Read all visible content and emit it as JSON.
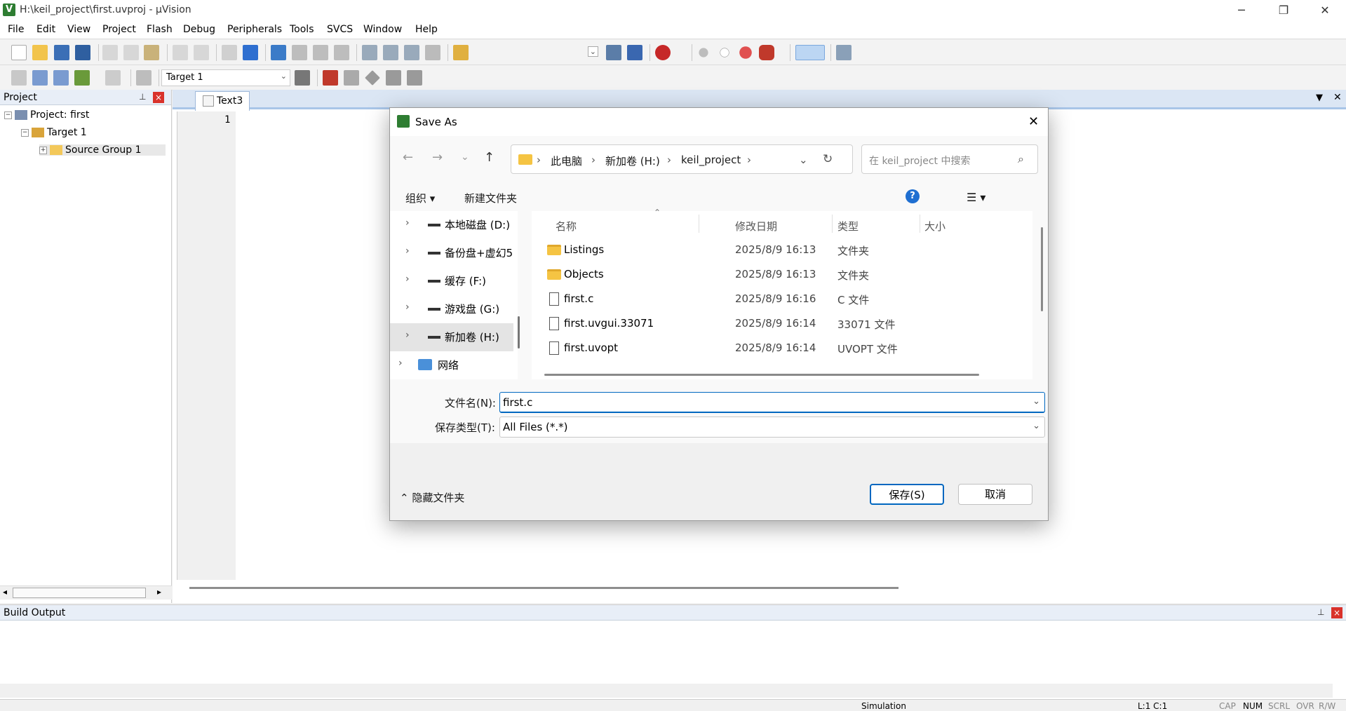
{
  "window": {
    "title": "H:\\keil_project\\first.uvproj - µVision",
    "app_icon": "V",
    "minimize": "─",
    "maximize": "❐",
    "close": "✕"
  },
  "menu": [
    "File",
    "Edit",
    "View",
    "Project",
    "Flash",
    "Debug",
    "Peripherals",
    "Tools",
    "SVCS",
    "Window",
    "Help"
  ],
  "toolbar2": {
    "target": "Target 1"
  },
  "project_panel": {
    "title": "Project",
    "pin": "⊥",
    "close": "×",
    "tree": {
      "project": "Project: first",
      "target": "Target 1",
      "group": "Source Group 1"
    }
  },
  "editor": {
    "tab": "Text3",
    "line_number": "1"
  },
  "build_output": {
    "title": "Build Output"
  },
  "statusbar": {
    "mode": "Simulation",
    "position": "L:1 C:1",
    "indicators": [
      "CAP",
      "NUM",
      "SCRL",
      "OVR",
      "R/W"
    ]
  },
  "dialog": {
    "title": "Save As",
    "close": "✕",
    "nav": {
      "back": "←",
      "forward": "→",
      "recent": "⌄",
      "up": "↑"
    },
    "breadcrumb": [
      "此电脑",
      "新加卷 (H:)",
      "keil_project"
    ],
    "refresh": "↻",
    "search_placeholder": "在 keil_project 中搜索",
    "commands": {
      "organize": "组织 ▾",
      "new_folder": "新建文件夹"
    },
    "help": "?",
    "nav_items": [
      {
        "label": "本地磁盘 (D:)"
      },
      {
        "label": "备份盘+虚幻5"
      },
      {
        "label": "缓存 (F:)"
      },
      {
        "label": "游戏盘 (G:)"
      },
      {
        "label": "新加卷 (H:)",
        "selected": true
      },
      {
        "label": "网络"
      }
    ],
    "columns": {
      "name": "名称",
      "date": "修改日期",
      "type": "类型",
      "size": "大小"
    },
    "files": [
      {
        "name": "Listings",
        "date": "2025/8/9 16:13",
        "type": "文件夹",
        "kind": "folder"
      },
      {
        "name": "Objects",
        "date": "2025/8/9 16:13",
        "type": "文件夹",
        "kind": "folder"
      },
      {
        "name": "first.c",
        "date": "2025/8/9 16:16",
        "type": "C 文件",
        "kind": "file"
      },
      {
        "name": "first.uvgui.33071",
        "date": "2025/8/9 16:14",
        "type": "33071 文件",
        "kind": "file"
      },
      {
        "name": "first.uvopt",
        "date": "2025/8/9 16:14",
        "type": "UVOPT 文件",
        "kind": "file"
      }
    ],
    "filename_label": "文件名(N):",
    "filename_value": "first.c",
    "filetype_label": "保存类型(T):",
    "filetype_value": "All Files (*.*)",
    "hide_folders": "隐藏文件夹",
    "save": "保存(S)",
    "cancel": "取消"
  }
}
